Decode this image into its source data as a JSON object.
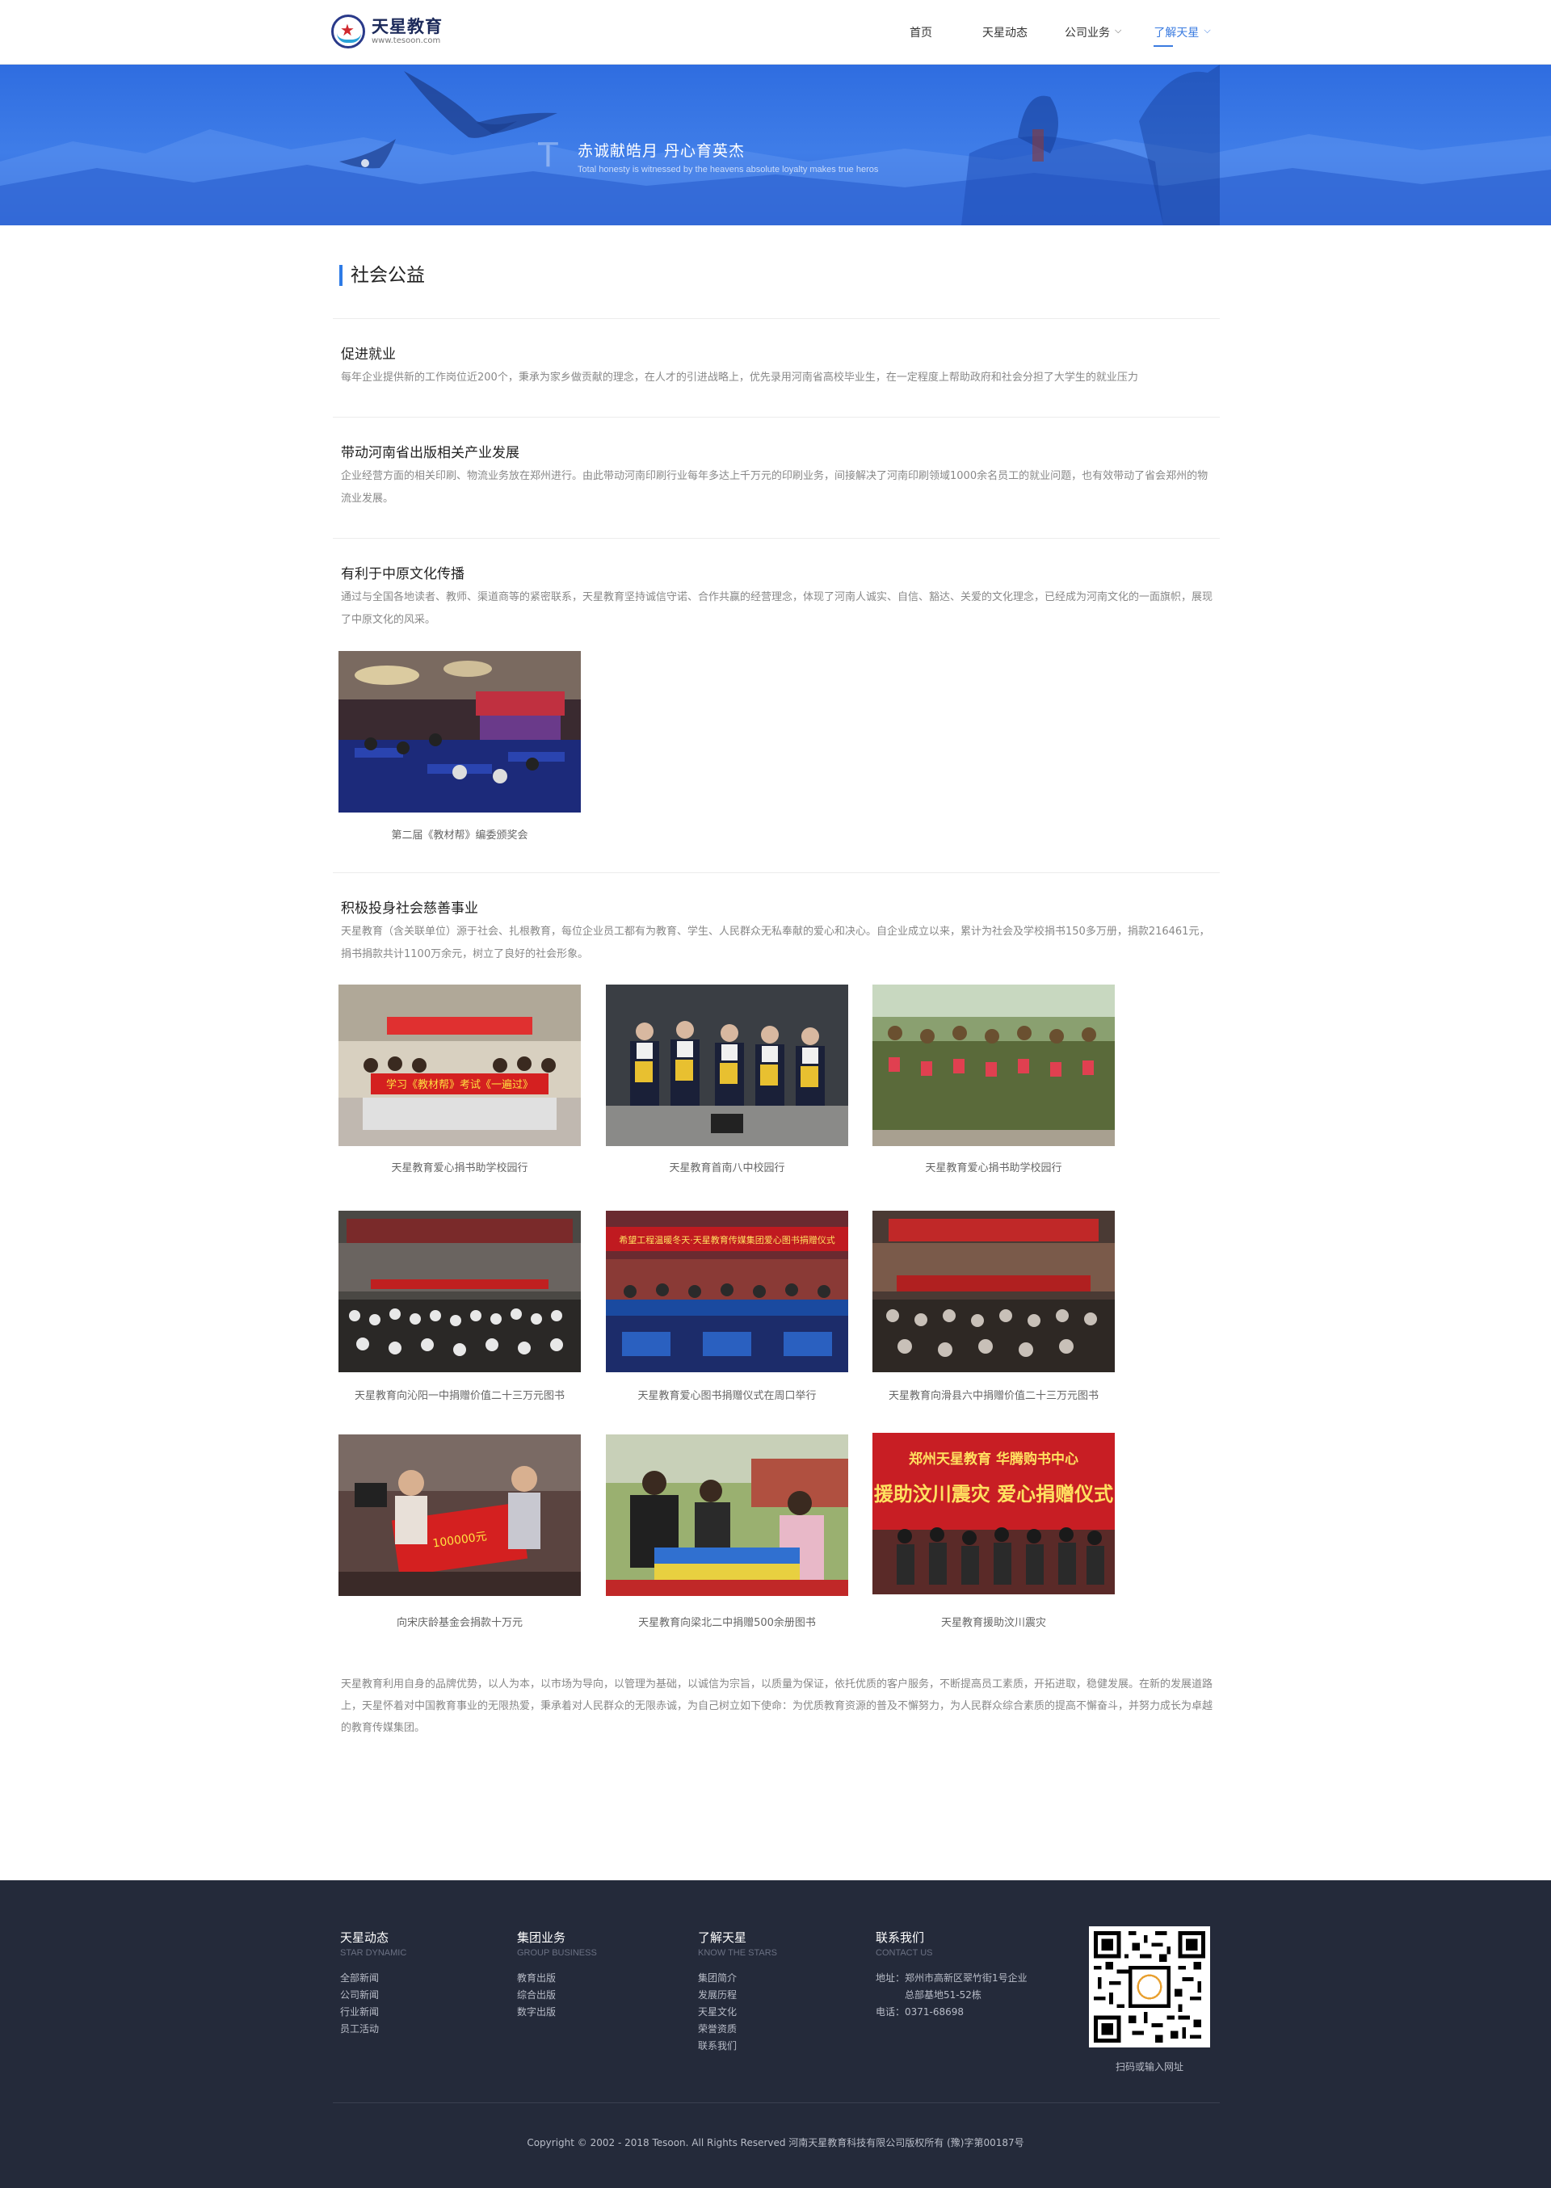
{
  "header": {
    "logo_name": "天星教育",
    "logo_url": "www.tesoon.com",
    "nav": [
      {
        "label": "首页"
      },
      {
        "label": "天星动态"
      },
      {
        "label": "公司业务"
      },
      {
        "label": "了解天星"
      }
    ]
  },
  "banner": {
    "letter": "T",
    "title": "赤诚献皓月  丹心育英杰",
    "subtitle": "Total honesty is witnessed by the heavens absolute loyalty makes true heros"
  },
  "section_title": "社会公益",
  "blocks": [
    {
      "heading": "促进就业",
      "text": "每年企业提供新的工作岗位近200个，秉承为家乡做贡献的理念，在人才的引进战略上，优先录用河南省高校毕业生，在一定程度上帮助政府和社会分担了大学生的就业压力"
    },
    {
      "heading": "带动河南省出版相关产业发展",
      "text": "企业经营方面的相关印刷、物流业务放在郑州进行。由此带动河南印刷行业每年多达上千万元的印刷业务，间接解决了河南印刷领域1000余名员工的就业问题，也有效带动了省会郑州的物流业发展。"
    },
    {
      "heading": "有利于中原文化传播",
      "text": "通过与全国各地读者、教师、渠道商等的紧密联系，天星教育坚持诚信守诺、合作共赢的经营理念，体现了河南人诚实、自信、豁达、关爱的文化理念，已经成为河南文化的一面旗帜，展现了中原文化的风采。"
    },
    {
      "heading": "积极投身社会慈善事业",
      "text": "天星教育（含关联单位）源于社会、扎根教育，每位企业员工都有为教育、学生、人民群众无私奉献的爱心和决心。自企业成立以来，累计为社会及学校捐书150多万册，捐款216461元，捐书捐款共计1100万余元，树立了良好的社会形象。"
    }
  ],
  "culture_photo_caption": "第二届《教材帮》编委颁奖会",
  "charity_photos": [
    {
      "caption": "天星教育爱心捐书助学校园行"
    },
    {
      "caption": "天星教育首南八中校园行"
    },
    {
      "caption": "天星教育爱心捐书助学校园行"
    },
    {
      "caption": "天星教育向沁阳一中捐赠价值二十三万元图书"
    },
    {
      "caption": "天星教育爱心图书捐赠仪式在周口举行"
    },
    {
      "caption": "天星教育向滑县六中捐赠价值二十三万元图书"
    },
    {
      "caption": "向宋庆龄基金会捐款十万元"
    },
    {
      "caption": "天星教育向梁北二中捐赠500余册图书"
    },
    {
      "caption": "天星教育援助汶川震灾"
    }
  ],
  "photo_texts": {
    "p1_banner": "学习《教材帮》考试《一遍过》",
    "p5_banner": "希望工程温暖冬天·天星教育传媒集团爱心图书捐赠仪式",
    "p7_check": "100000元",
    "p9_line1": "郑州天星教育  华腾购书中心",
    "p9_line2": "援助汶川震灾  爱心捐赠仪式"
  },
  "closing": "天星教育利用自身的品牌优势，以人为本，以市场为导向，以管理为基础，以诚信为宗旨，以质量为保证，依托优质的客户服务，不断提高员工素质，开拓进取，稳健发展。在新的发展道路上，天星怀着对中国教育事业的无限热爱，秉承着对人民群众的无限赤诚，为自己树立如下使命：为优质教育资源的普及不懈努力，为人民群众综合素质的提高不懈奋斗，并努力成长为卓越的教育传媒集团。",
  "footer": {
    "columns": [
      {
        "title": "天星动态",
        "en": "STAR DYNAMIC",
        "items": [
          "全部新闻",
          "公司新闻",
          "行业新闻",
          "员工活动"
        ]
      },
      {
        "title": "集团业务",
        "en": "GROUP BUSINESS",
        "items": [
          "教育出版",
          "综合出版",
          "数字出版"
        ]
      },
      {
        "title": "了解天星",
        "en": "KNOW THE STARS",
        "items": [
          "集团简介",
          "发展历程",
          "天星文化",
          "荣誉资质",
          "联系我们"
        ]
      },
      {
        "title": "联系我们",
        "en": "CONTACT US",
        "items": [
          "地址：郑州市高新区翠竹街1号企业",
          "　　　总部基地51-52栋",
          "电话：0371-68698"
        ]
      }
    ],
    "qr_caption": "扫码或输入网址",
    "copyright": "Copyright © 2002 - 2018 Tesoon. All Rights Reserved  河南天星教育科技有限公司版权所有 (豫)字第00187号"
  },
  "colors": {
    "accent": "#3a7be0",
    "banner": "#3f7de8",
    "footer_bg": "#242a3a"
  }
}
